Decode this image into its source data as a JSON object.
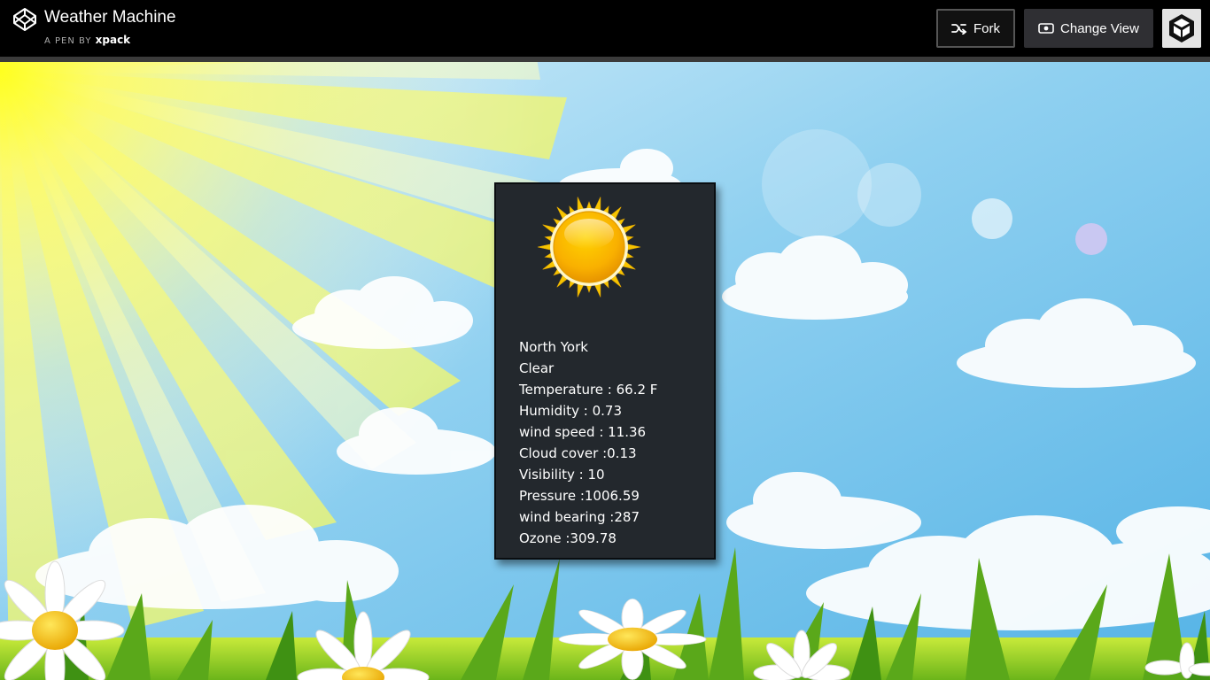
{
  "header": {
    "title": "Weather Machine",
    "byline_prefix": "A PEN BY",
    "author": "xpack",
    "logo_icon": "codepen-logo-icon",
    "fork_label": "Fork",
    "fork_icon": "fork-icon",
    "change_view_label": "Change View",
    "change_view_icon": "eye-icon",
    "avatar_icon": "user-avatar-icon"
  },
  "weather": {
    "icon": "sun-icon",
    "location": "North York",
    "summary": "Clear",
    "temperature": "Temperature : 66.2 F",
    "humidity": "Humidity : 0.73",
    "wind_speed": "wind speed : 11.36",
    "cloud_cover": "Cloud cover :0.13",
    "visibility": "Visibility : 10",
    "pressure": "Pressure :1006.59",
    "wind_bearing": "wind bearing :287",
    "ozone": "Ozone :309.78"
  },
  "colors": {
    "sky_top": "#4aa8de",
    "sky_bottom": "#e6f6fb",
    "sun_glow": "#ffff33",
    "grass": "#7cc020",
    "card_bg": "#23282d"
  }
}
